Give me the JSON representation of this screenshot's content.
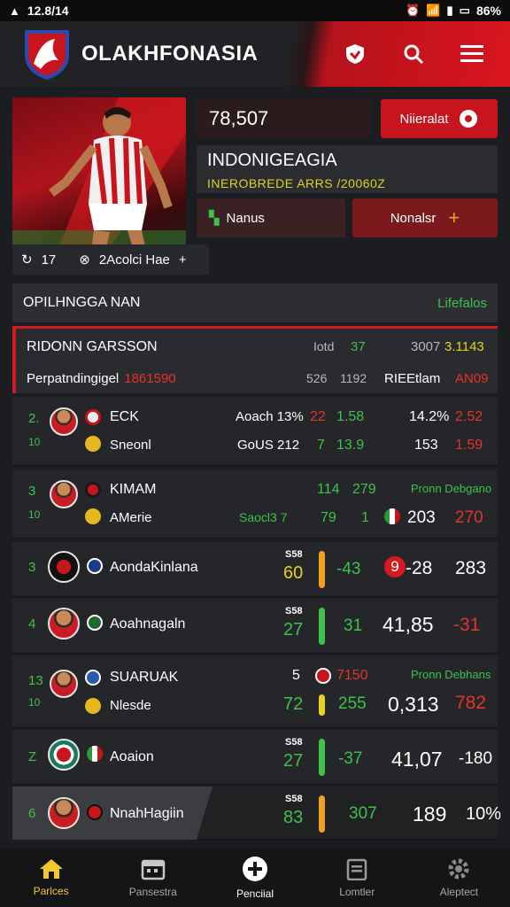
{
  "status_bar": {
    "time": "12.8/14",
    "battery": "86%"
  },
  "header": {
    "title": "OLAKHFONASIA"
  },
  "hero": {
    "stat_value": "78,507",
    "follow_label": "Niieralat",
    "player_name": "INDONIGEAGIA",
    "player_sub": "INEROBREDE ARRS /20060Z",
    "nav_left_label": "Nanus",
    "nav_right_label": "Nonalsr",
    "meta_count": "17",
    "meta_label": "2Acolci Hae"
  },
  "section": {
    "title": "OPILHNGGA NAN",
    "link": "Lifefalos"
  },
  "highlight": {
    "name": "RIDONN GARSSON",
    "sub_label": "Perpatndingigel",
    "sub_value": "1861590",
    "c1a": "Iotd",
    "c1b": "37",
    "c1c": "3007",
    "c1d": "3.1143",
    "c2a": "526",
    "c2b": "1192",
    "c2c": "RIEEtlam",
    "c2d": "AN09"
  },
  "rows": [
    {
      "rank_a": "2.",
      "rank_b": "10",
      "name_a": "ECK",
      "name_b": "Sneonl",
      "l1": "Aoach 13%",
      "l1b": "22",
      "l1c": "1.58",
      "l1d": "14.2%",
      "l1e": "2.52",
      "l2": "GoUS 212",
      "l2b": "7",
      "l2c": "13.9",
      "l2d": "153",
      "l2e": "1.59"
    },
    {
      "rank_a": "3",
      "rank_b": "10",
      "name_a": "KIMAM",
      "name_b": "AMerie",
      "l1b": "114",
      "l1c": "279",
      "l1e": "Pronn Debgano",
      "l2": "Saocl3 7",
      "l2b": "79",
      "l2c": "1",
      "l2d": "203",
      "l2e": "270"
    },
    {
      "rank_a": "3",
      "name_a": "AondaKinlana",
      "top": "S58",
      "v1": "60",
      "v2": "-43",
      "v3": "9",
      "v4": "-28",
      "v5": "283"
    },
    {
      "rank_a": "4",
      "name_a": "Aoahnagaln",
      "top": "S58",
      "v1": "27",
      "v2": "31",
      "v3": "41,85",
      "v4": "-31"
    },
    {
      "rank_a": "13",
      "rank_b": "10",
      "name_a": "SUARUAK",
      "name_b": "Nlesde",
      "t1": "5",
      "t2": "7150",
      "tr": "Pronn Debhans",
      "v1": "72",
      "v2": "255",
      "v3": "0,313",
      "v4": "782"
    },
    {
      "rank_a": "Z",
      "name_a": "Aoaion",
      "top": "S58",
      "v1": "27",
      "v2": "-37",
      "v3": "41,07",
      "v4": "-180"
    },
    {
      "rank_a": "6",
      "name_a": "NnahHagiin",
      "top": "S58",
      "v1": "83",
      "v2": "307",
      "v3": "189",
      "v4": "10%"
    }
  ],
  "bottom_nav": [
    {
      "label": "Parlces",
      "icon": "home-icon"
    },
    {
      "label": "Pansestra",
      "icon": "calendar-icon"
    },
    {
      "label": "Penciial",
      "icon": "plus-icon"
    },
    {
      "label": "Lomtler",
      "icon": "clipboard-icon"
    },
    {
      "label": "Aleptect",
      "icon": "gear-icon"
    }
  ],
  "colors": {
    "accent_red": "#d61a22",
    "accent_green": "#3ec24a",
    "accent_yellow": "#f2c72a"
  }
}
